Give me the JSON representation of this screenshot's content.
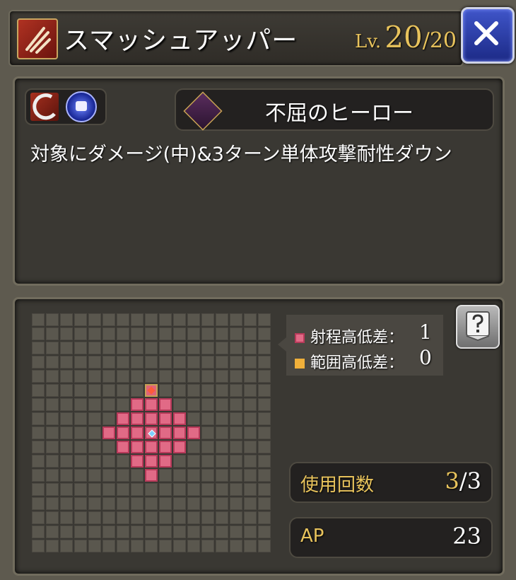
{
  "header": {
    "skill_icon": "claw-slash-icon",
    "skill_name": "スマッシュアッパー",
    "level_prefix": "Lv.",
    "level_current": "20",
    "level_separator": "/",
    "level_max": "20",
    "close_icon": "close-x-icon"
  },
  "details": {
    "element_icons": [
      "slash-element-icon",
      "fist-orb-icon"
    ],
    "trait_icon": "hero-trait-icon",
    "trait_label": "不屈のヒーロー",
    "description": "対象にダメージ(中)&3ターン単体攻撃耐性ダウン"
  },
  "range": {
    "legend": {
      "range_height_label": "射程高低差：",
      "range_height_value": "1",
      "area_height_label": "範囲高低差：",
      "area_height_value": "0"
    },
    "help_icon": "help-book-icon",
    "uses_label": "使用回数",
    "uses_current": "3",
    "uses_separator": "/",
    "uses_max": "3",
    "ap_label": "AP",
    "ap_value": "23",
    "colors": {
      "range": "#e16a86",
      "area": "#f0b03a",
      "accent": "#e8c35c"
    }
  }
}
